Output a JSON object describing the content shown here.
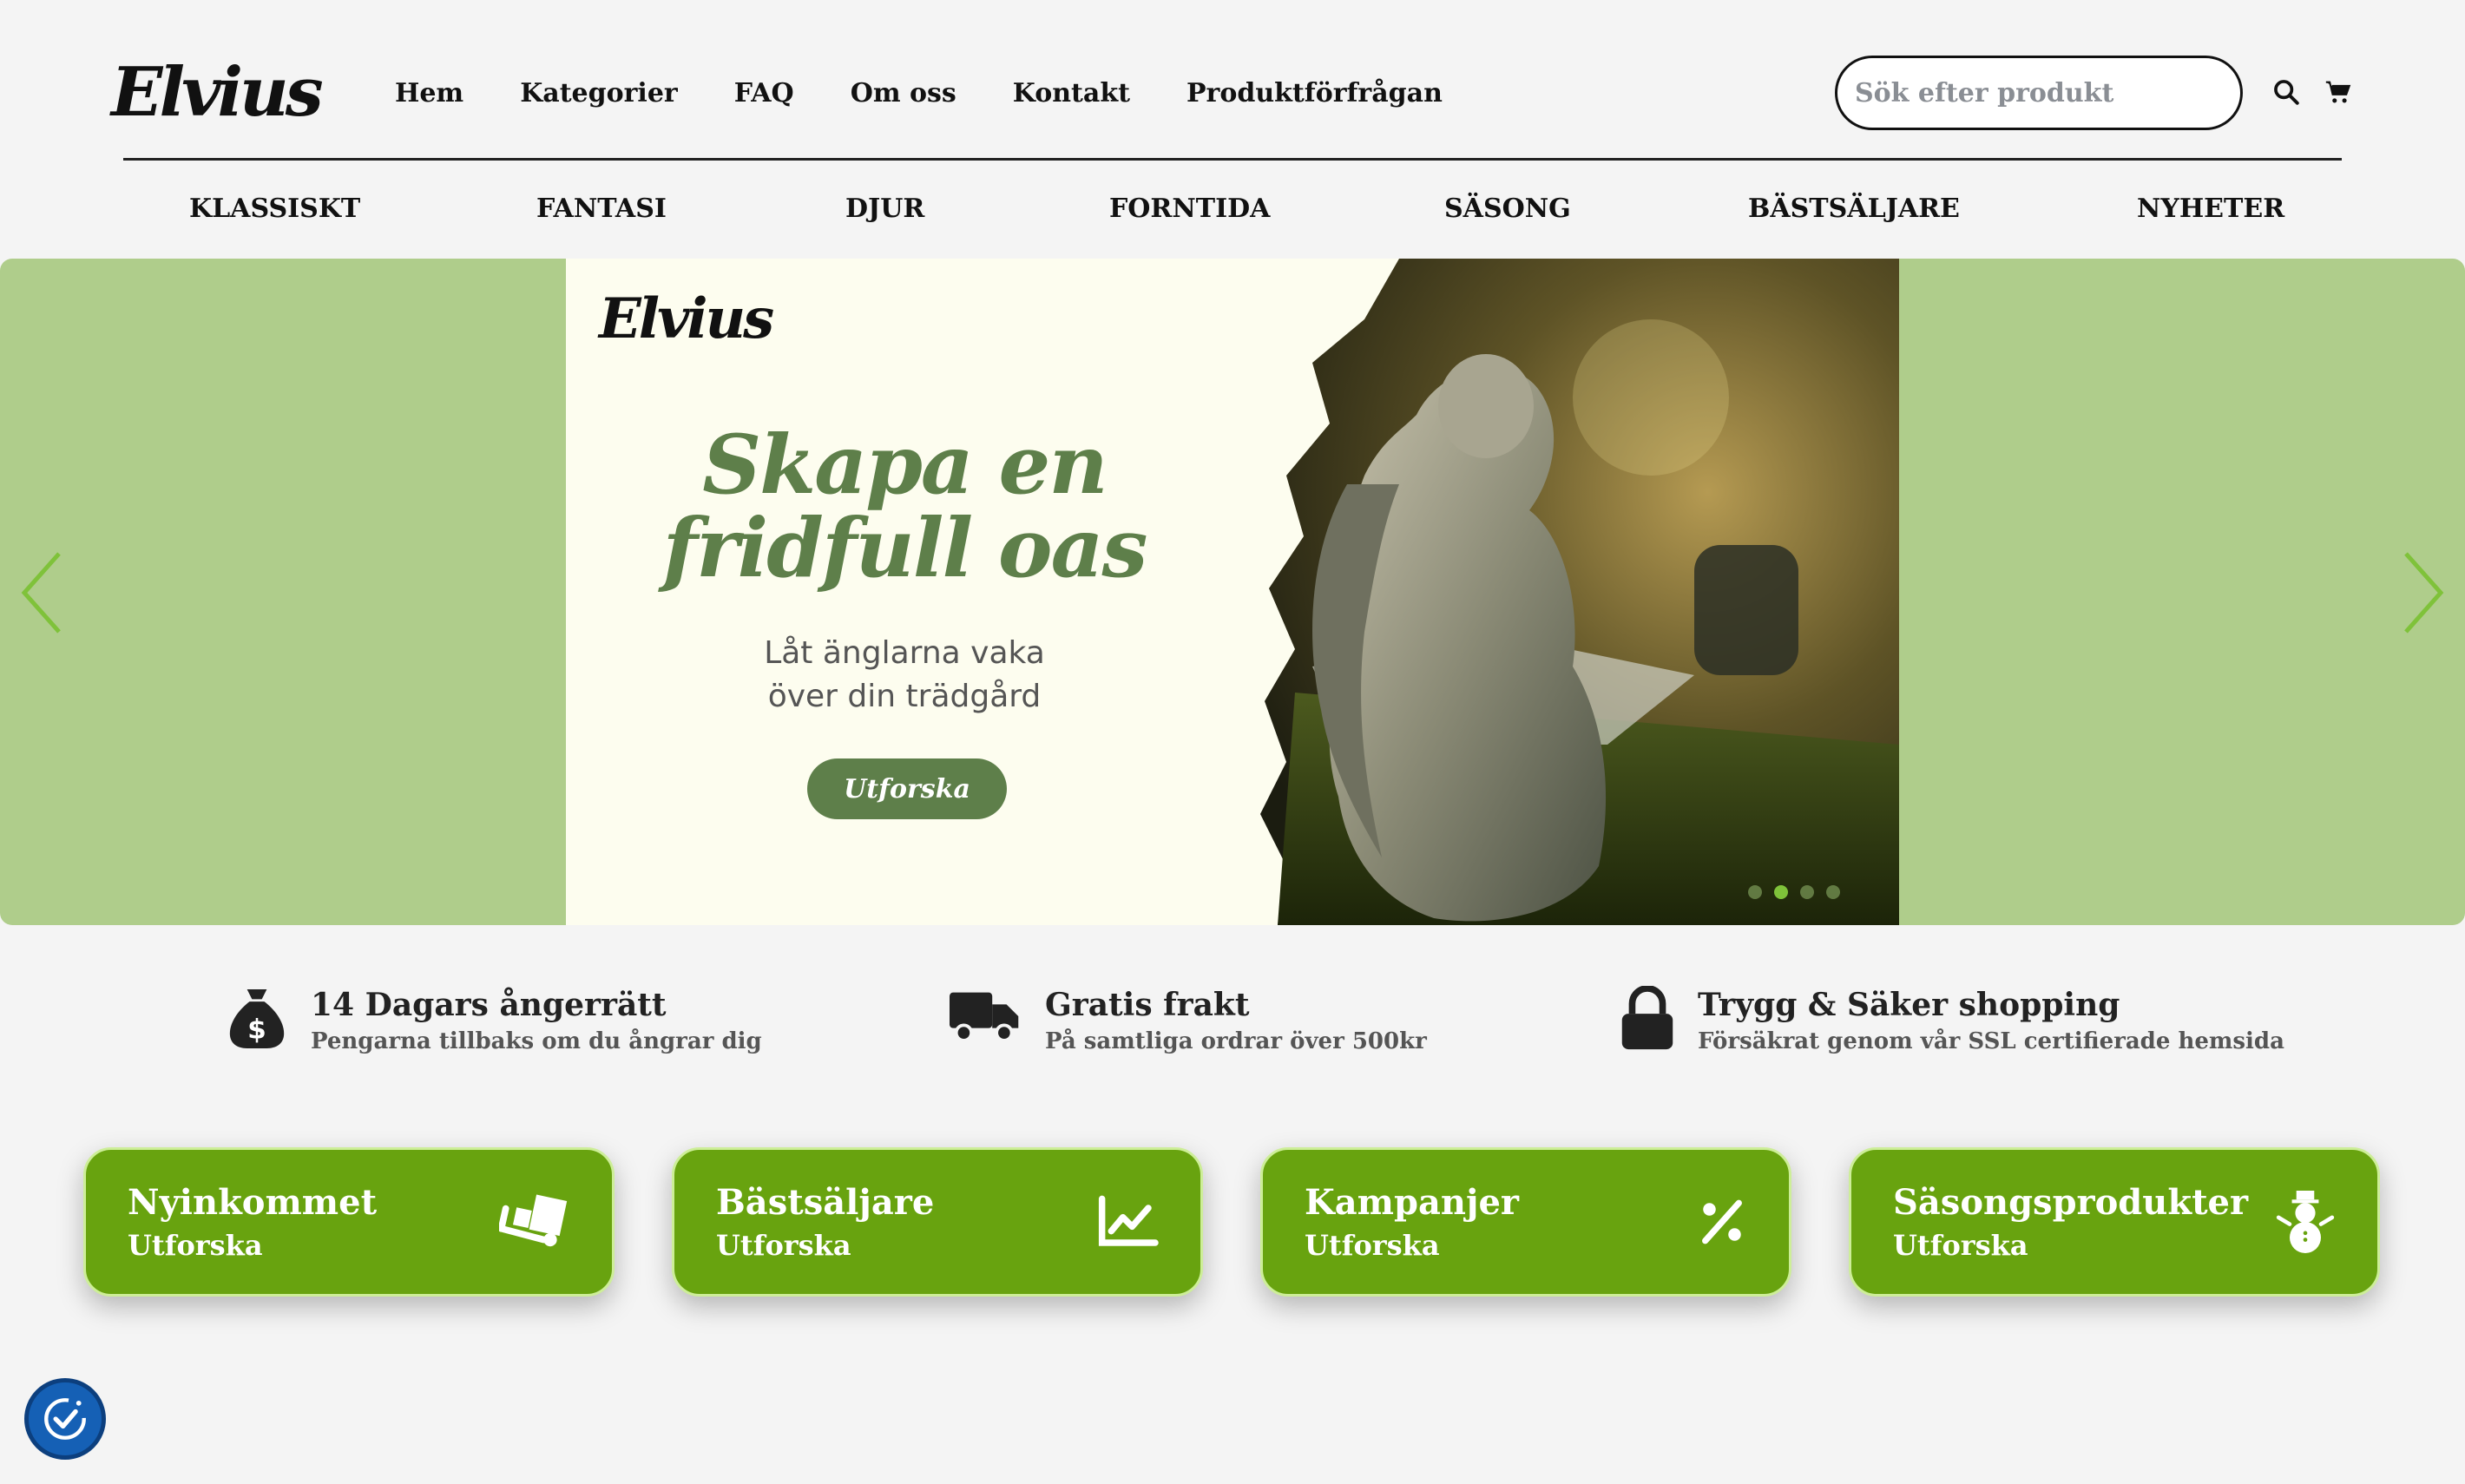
{
  "header": {
    "logo": "Elvius",
    "nav": [
      "Hem",
      "Kategorier",
      "FAQ",
      "Om oss",
      "Kontakt",
      "Produktförfrågan"
    ],
    "search_placeholder": "Sök efter produkt",
    "search_icon": "search-icon",
    "cart_icon": "cart-icon"
  },
  "categories": [
    "KLASSISKT",
    "FANTASI",
    "DJUR",
    "FORNTIDA",
    "SÄSONG",
    "BÄSTSÄLJARE",
    "NYHETER"
  ],
  "hero": {
    "logo": "Elvius",
    "headline_1": "Skapa en",
    "headline_2": "fridfull oas",
    "sub_1": "Låt änglarna vaka",
    "sub_2": "över din trädgård",
    "button": "Utforska",
    "slides": 4,
    "active_slide": 2,
    "colors": {
      "side": "#afcd8b",
      "banner": "#fdfdef",
      "accent": "#5e7f4a",
      "arrow": "#7fc23a"
    }
  },
  "features": [
    {
      "icon": "money-bag-icon",
      "title": "14 Dagars ångerrätt",
      "subtitle": "Pengarna tillbaks om du ångrar dig"
    },
    {
      "icon": "truck-icon",
      "title": "Gratis frakt",
      "subtitle": "På samtliga ordrar över 500kr"
    },
    {
      "icon": "lock-icon",
      "title": "Trygg & Säker shopping",
      "subtitle": "Försäkrat genom vår SSL certifierade hemsida"
    }
  ],
  "cards": [
    {
      "title": "Nyinkommet",
      "subtitle": "Utforska",
      "icon": "dolly-icon"
    },
    {
      "title": "Bästsäljare",
      "subtitle": "Utforska",
      "icon": "chart-line-icon"
    },
    {
      "title": "Kampanjer",
      "subtitle": "Utforska",
      "icon": "percent-icon"
    },
    {
      "title": "Säsongsprodukter",
      "subtitle": "Utforska",
      "icon": "snowman-icon"
    }
  ],
  "card_color": "#68a30f",
  "accessibility_icon": "accessibility-icon"
}
